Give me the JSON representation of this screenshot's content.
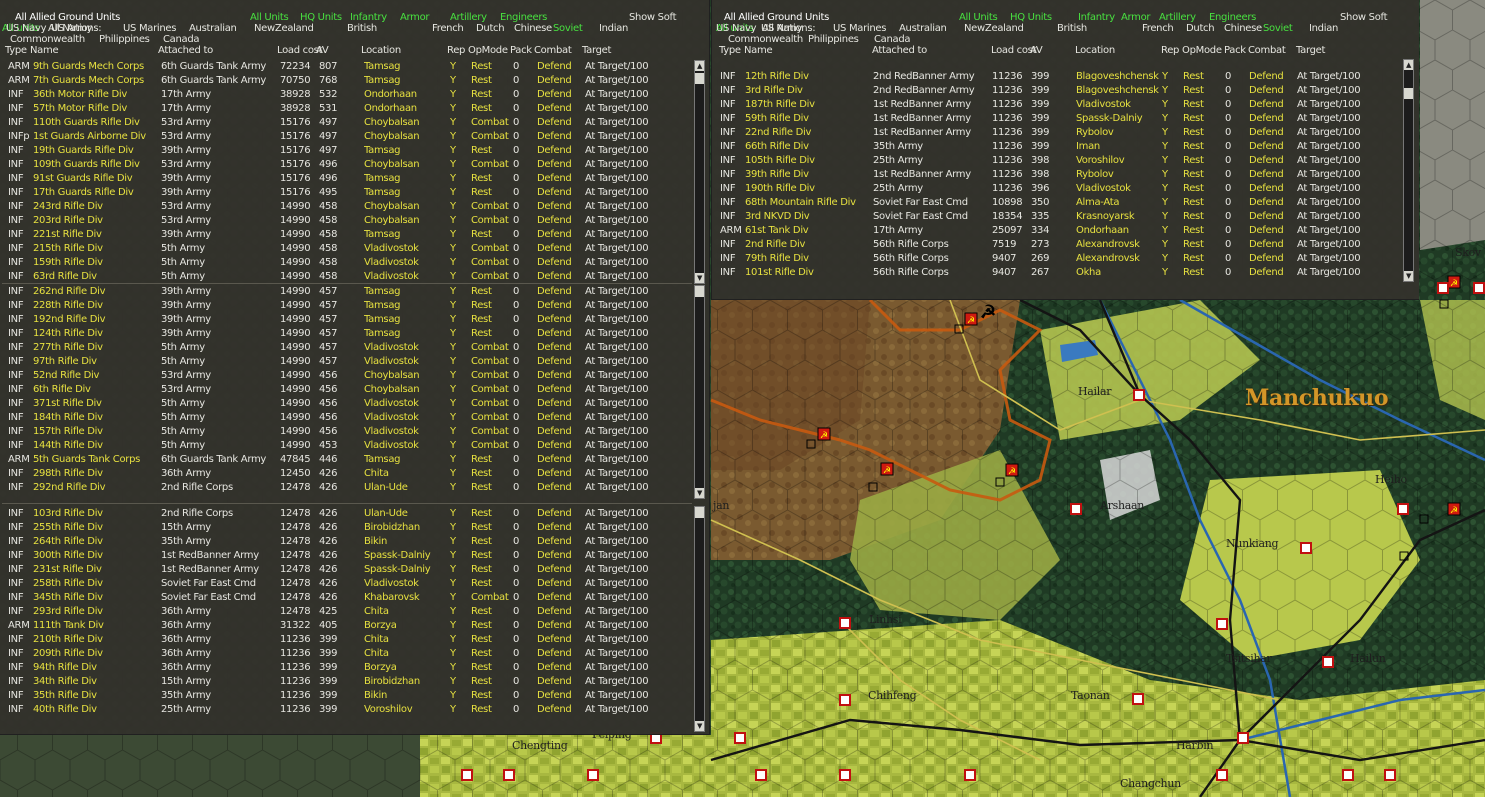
{
  "colors": {
    "green_link": "#48e040",
    "yellow_text": "#e6e040",
    "panel_bg": "#34322c",
    "soviet_flag": "#d01a10",
    "japan_flag": "#c01010"
  },
  "map": {
    "region_label": "Manchukuo",
    "cities": [
      "Hailar",
      "Arshaan",
      "Heiho",
      "Nunkiang",
      "Linhsi",
      "Tsitsihar",
      "Hailun",
      "Chihfeng",
      "Taonan",
      "Chengting",
      "Peiping",
      "Harbin",
      "Changchun",
      "Skov",
      "jan"
    ]
  },
  "right_panel": {
    "title": "All Allied Ground Units",
    "filters": [
      "All Units",
      "HQ Units",
      "Infantry",
      "Armor",
      "Artillery",
      "Engineers"
    ],
    "show_soft": "Show Soft",
    "all_units": "All units",
    "all_nations": "All Nations:",
    "nations": [
      "US Navy",
      "US Army",
      "US Marines",
      "Australian",
      "NewZealand",
      "British",
      "French",
      "Dutch",
      "Chinese",
      "Soviet",
      "Indian",
      "Commonwealth",
      "Philippines",
      "Canada"
    ],
    "columns": [
      "Type",
      "Name",
      "Attached to",
      "Load cost",
      "AV",
      "Location",
      "Rep",
      "OpMode",
      "Pack",
      "Combat",
      "Target"
    ],
    "rows": [
      [
        "INF",
        "12th Rifle Div",
        "2nd RedBanner Army",
        "11236",
        "399",
        "Blagoveshchensk",
        "Y",
        "Rest",
        "0",
        "Defend",
        "At Target/100"
      ],
      [
        "INF",
        "3rd Rifle Div",
        "2nd RedBanner Army",
        "11236",
        "399",
        "Blagoveshchensk",
        "Y",
        "Rest",
        "0",
        "Defend",
        "At Target/100"
      ],
      [
        "INF",
        "187th Rifle Div",
        "1st RedBanner Army",
        "11236",
        "399",
        "Vladivostok",
        "Y",
        "Rest",
        "0",
        "Defend",
        "At Target/100"
      ],
      [
        "INF",
        "59th Rifle Div",
        "1st RedBanner Army",
        "11236",
        "399",
        "Spassk-Dalniy",
        "Y",
        "Rest",
        "0",
        "Defend",
        "At Target/100"
      ],
      [
        "INF",
        "22nd Rifle Div",
        "1st RedBanner Army",
        "11236",
        "399",
        "Rybolov",
        "Y",
        "Rest",
        "0",
        "Defend",
        "At Target/100"
      ],
      [
        "INF",
        "66th Rifle Div",
        "35th Army",
        "11236",
        "399",
        "Iman",
        "Y",
        "Rest",
        "0",
        "Defend",
        "At Target/100"
      ],
      [
        "INF",
        "105th Rifle Div",
        "25th Army",
        "11236",
        "398",
        "Voroshilov",
        "Y",
        "Rest",
        "0",
        "Defend",
        "At Target/100"
      ],
      [
        "INF",
        "39th Rifle Div",
        "1st RedBanner Army",
        "11236",
        "398",
        "Rybolov",
        "Y",
        "Rest",
        "0",
        "Defend",
        "At Target/100"
      ],
      [
        "INF",
        "190th Rifle Div",
        "25th Army",
        "11236",
        "396",
        "Vladivostok",
        "Y",
        "Rest",
        "0",
        "Defend",
        "At Target/100"
      ],
      [
        "INF",
        "68th Mountain Rifle Div",
        "Soviet Far East Cmd",
        "10898",
        "350",
        "Alma-Ata",
        "Y",
        "Rest",
        "0",
        "Defend",
        "At Target/100"
      ],
      [
        "INF",
        "3rd NKVD Div",
        "Soviet Far East Cmd",
        "18354",
        "335",
        "Krasnoyarsk",
        "Y",
        "Rest",
        "0",
        "Defend",
        "At Target/100"
      ],
      [
        "ARM",
        "61st Tank Div",
        "17th Army",
        "25097",
        "334",
        "Ondorhaan",
        "Y",
        "Rest",
        "0",
        "Defend",
        "At Target/100"
      ],
      [
        "INF",
        "2nd Rifle Div",
        "56th Rifle Corps",
        "7519",
        "273",
        "Alexandrovsk",
        "Y",
        "Rest",
        "0",
        "Defend",
        "At Target/100"
      ],
      [
        "INF",
        "79th Rifle Div",
        "56th Rifle Corps",
        "9407",
        "269",
        "Alexandrovsk",
        "Y",
        "Rest",
        "0",
        "Defend",
        "At Target/100"
      ],
      [
        "INF",
        "101st Rifle Div",
        "56th Rifle Corps",
        "9407",
        "267",
        "Okha",
        "Y",
        "Rest",
        "0",
        "Defend",
        "At Target/100"
      ]
    ]
  },
  "left_panel": {
    "title": "All Allied Ground Units",
    "filters": [
      "All Units",
      "HQ Units",
      "Infantry",
      "Armor",
      "Artillery",
      "Engineers"
    ],
    "show_soft": "Show Soft",
    "all_units": "All units",
    "all_nations": "All Nations:",
    "nations": [
      "US Navy",
      "US Army",
      "US Marines",
      "Australian",
      "NewZealand",
      "British",
      "French",
      "Dutch",
      "Chinese",
      "Soviet",
      "Indian",
      "Commonwealth",
      "Philippines",
      "Canada"
    ],
    "columns": [
      "Type",
      "Name",
      "Attached to",
      "Load cost",
      "AV",
      "Location",
      "Rep",
      "OpMode",
      "Pack",
      "Combat",
      "Target"
    ],
    "sections": [
      [
        [
          "ARM",
          "9th Guards Mech Corps",
          "6th Guards Tank Army",
          "72234",
          "807",
          "Tamsag",
          "Y",
          "Rest",
          "0",
          "Defend",
          "At Target/100"
        ],
        [
          "ARM",
          "7th Guards Mech Corps",
          "6th Guards Tank Army",
          "70750",
          "768",
          "Tamsag",
          "Y",
          "Rest",
          "0",
          "Defend",
          "At Target/100"
        ],
        [
          "INF",
          "36th Motor Rifle Div",
          "17th Army",
          "38928",
          "532",
          "Ondorhaan",
          "Y",
          "Rest",
          "0",
          "Defend",
          "At Target/100"
        ],
        [
          "INF",
          "57th Motor Rifle Div",
          "17th Army",
          "38928",
          "531",
          "Ondorhaan",
          "Y",
          "Rest",
          "0",
          "Defend",
          "At Target/100"
        ],
        [
          "INF",
          "110th Guards Rifle Div",
          "53rd Army",
          "15176",
          "497",
          "Choybalsan",
          "Y",
          "Combat",
          "0",
          "Defend",
          "At Target/100"
        ],
        [
          "INFp",
          "1st Guards Airborne Div",
          "53rd Army",
          "15176",
          "497",
          "Choybalsan",
          "Y",
          "Combat",
          "0",
          "Defend",
          "At Target/100"
        ],
        [
          "INF",
          "19th Guards Rifle Div",
          "39th Army",
          "15176",
          "497",
          "Tamsag",
          "Y",
          "Rest",
          "0",
          "Defend",
          "At Target/100"
        ],
        [
          "INF",
          "109th Guards Rifle Div",
          "53rd Army",
          "15176",
          "496",
          "Choybalsan",
          "Y",
          "Combat",
          "0",
          "Defend",
          "At Target/100"
        ],
        [
          "INF",
          "91st Guards Rifle Div",
          "39th Army",
          "15176",
          "496",
          "Tamsag",
          "Y",
          "Rest",
          "0",
          "Defend",
          "At Target/100"
        ],
        [
          "INF",
          "17th Guards Rifle Div",
          "39th Army",
          "15176",
          "495",
          "Tamsag",
          "Y",
          "Rest",
          "0",
          "Defend",
          "At Target/100"
        ],
        [
          "INF",
          "243rd Rifle Div",
          "53rd Army",
          "14990",
          "458",
          "Choybalsan",
          "Y",
          "Combat",
          "0",
          "Defend",
          "At Target/100"
        ],
        [
          "INF",
          "203rd Rifle Div",
          "53rd Army",
          "14990",
          "458",
          "Choybalsan",
          "Y",
          "Combat",
          "0",
          "Defend",
          "At Target/100"
        ],
        [
          "INF",
          "221st Rifle Div",
          "39th Army",
          "14990",
          "458",
          "Tamsag",
          "Y",
          "Rest",
          "0",
          "Defend",
          "At Target/100"
        ],
        [
          "INF",
          "215th Rifle Div",
          "5th Army",
          "14990",
          "458",
          "Vladivostok",
          "Y",
          "Combat",
          "0",
          "Defend",
          "At Target/100"
        ],
        [
          "INF",
          "159th Rifle Div",
          "5th Army",
          "14990",
          "458",
          "Vladivostok",
          "Y",
          "Combat",
          "0",
          "Defend",
          "At Target/100"
        ],
        [
          "INF",
          "63rd Rifle Div",
          "5th Army",
          "14990",
          "458",
          "Vladivostok",
          "Y",
          "Combat",
          "0",
          "Defend",
          "At Target/100"
        ]
      ],
      [
        [
          "INF",
          "262nd Rifle Div",
          "39th Army",
          "14990",
          "457",
          "Tamsag",
          "Y",
          "Rest",
          "0",
          "Defend",
          "At Target/100"
        ],
        [
          "INF",
          "228th Rifle Div",
          "39th Army",
          "14990",
          "457",
          "Tamsag",
          "Y",
          "Rest",
          "0",
          "Defend",
          "At Target/100"
        ],
        [
          "INF",
          "192nd Rifle Div",
          "39th Army",
          "14990",
          "457",
          "Tamsag",
          "Y",
          "Rest",
          "0",
          "Defend",
          "At Target/100"
        ],
        [
          "INF",
          "124th Rifle Div",
          "39th Army",
          "14990",
          "457",
          "Tamsag",
          "Y",
          "Rest",
          "0",
          "Defend",
          "At Target/100"
        ],
        [
          "INF",
          "277th Rifle Div",
          "5th Army",
          "14990",
          "457",
          "Vladivostok",
          "Y",
          "Combat",
          "0",
          "Defend",
          "At Target/100"
        ],
        [
          "INF",
          "97th Rifle Div",
          "5th Army",
          "14990",
          "457",
          "Vladivostok",
          "Y",
          "Combat",
          "0",
          "Defend",
          "At Target/100"
        ],
        [
          "INF",
          "52nd Rifle Div",
          "53rd Army",
          "14990",
          "456",
          "Choybalsan",
          "Y",
          "Combat",
          "0",
          "Defend",
          "At Target/100"
        ],
        [
          "INF",
          "6th Rifle Div",
          "53rd Army",
          "14990",
          "456",
          "Choybalsan",
          "Y",
          "Combat",
          "0",
          "Defend",
          "At Target/100"
        ],
        [
          "INF",
          "371st Rifle Div",
          "5th Army",
          "14990",
          "456",
          "Vladivostok",
          "Y",
          "Combat",
          "0",
          "Defend",
          "At Target/100"
        ],
        [
          "INF",
          "184th Rifle Div",
          "5th Army",
          "14990",
          "456",
          "Vladivostok",
          "Y",
          "Combat",
          "0",
          "Defend",
          "At Target/100"
        ],
        [
          "INF",
          "157th Rifle Div",
          "5th Army",
          "14990",
          "456",
          "Vladivostok",
          "Y",
          "Combat",
          "0",
          "Defend",
          "At Target/100"
        ],
        [
          "INF",
          "144th Rifle Div",
          "5th Army",
          "14990",
          "453",
          "Vladivostok",
          "Y",
          "Combat",
          "0",
          "Defend",
          "At Target/100"
        ],
        [
          "ARM",
          "5th Guards Tank Corps",
          "6th Guards Tank Army",
          "47845",
          "446",
          "Tamsag",
          "Y",
          "Rest",
          "0",
          "Defend",
          "At Target/100"
        ],
        [
          "INF",
          "298th Rifle Div",
          "36th Army",
          "12450",
          "426",
          "Chita",
          "Y",
          "Rest",
          "0",
          "Defend",
          "At Target/100"
        ],
        [
          "INF",
          "292nd Rifle Div",
          "2nd Rifle Corps",
          "12478",
          "426",
          "Ulan-Ude",
          "Y",
          "Rest",
          "0",
          "Defend",
          "At Target/100"
        ]
      ],
      [
        [
          "INF",
          "103rd Rifle Div",
          "2nd Rifle Corps",
          "12478",
          "426",
          "Ulan-Ude",
          "Y",
          "Rest",
          "0",
          "Defend",
          "At Target/100"
        ],
        [
          "INF",
          "255th Rifle Div",
          "15th Army",
          "12478",
          "426",
          "Birobidzhan",
          "Y",
          "Rest",
          "0",
          "Defend",
          "At Target/100"
        ],
        [
          "INF",
          "264th Rifle Div",
          "35th Army",
          "12478",
          "426",
          "Bikin",
          "Y",
          "Rest",
          "0",
          "Defend",
          "At Target/100"
        ],
        [
          "INF",
          "300th Rifle Div",
          "1st RedBanner Army",
          "12478",
          "426",
          "Spassk-Dalniy",
          "Y",
          "Rest",
          "0",
          "Defend",
          "At Target/100"
        ],
        [
          "INF",
          "231st Rifle Div",
          "1st RedBanner Army",
          "12478",
          "426",
          "Spassk-Dalniy",
          "Y",
          "Rest",
          "0",
          "Defend",
          "At Target/100"
        ],
        [
          "INF",
          "258th Rifle Div",
          "Soviet Far East Cmd",
          "12478",
          "426",
          "Vladivostok",
          "Y",
          "Rest",
          "0",
          "Defend",
          "At Target/100"
        ],
        [
          "INF",
          "345th Rifle Div",
          "Soviet Far East Cmd",
          "12478",
          "426",
          "Khabarovsk",
          "Y",
          "Combat",
          "0",
          "Defend",
          "At Target/100"
        ],
        [
          "INF",
          "293rd Rifle Div",
          "36th Army",
          "12478",
          "425",
          "Chita",
          "Y",
          "Rest",
          "0",
          "Defend",
          "At Target/100"
        ],
        [
          "ARM",
          "111th Tank Div",
          "36th Army",
          "31322",
          "405",
          "Borzya",
          "Y",
          "Rest",
          "0",
          "Defend",
          "At Target/100"
        ],
        [
          "INF",
          "210th Rifle Div",
          "36th Army",
          "11236",
          "399",
          "Chita",
          "Y",
          "Rest",
          "0",
          "Defend",
          "At Target/100"
        ],
        [
          "INF",
          "209th Rifle Div",
          "36th Army",
          "11236",
          "399",
          "Chita",
          "Y",
          "Rest",
          "0",
          "Defend",
          "At Target/100"
        ],
        [
          "INF",
          "94th Rifle Div",
          "36th Army",
          "11236",
          "399",
          "Borzya",
          "Y",
          "Rest",
          "0",
          "Defend",
          "At Target/100"
        ],
        [
          "INF",
          "34th Rifle Div",
          "15th Army",
          "11236",
          "399",
          "Birobidzhan",
          "Y",
          "Rest",
          "0",
          "Defend",
          "At Target/100"
        ],
        [
          "INF",
          "35th Rifle Div",
          "35th Army",
          "11236",
          "399",
          "Bikin",
          "Y",
          "Rest",
          "0",
          "Defend",
          "At Target/100"
        ],
        [
          "INF",
          "40th Rifle Div",
          "25th Army",
          "11236",
          "399",
          "Voroshilov",
          "Y",
          "Rest",
          "0",
          "Defend",
          "At Target/100"
        ]
      ]
    ]
  }
}
